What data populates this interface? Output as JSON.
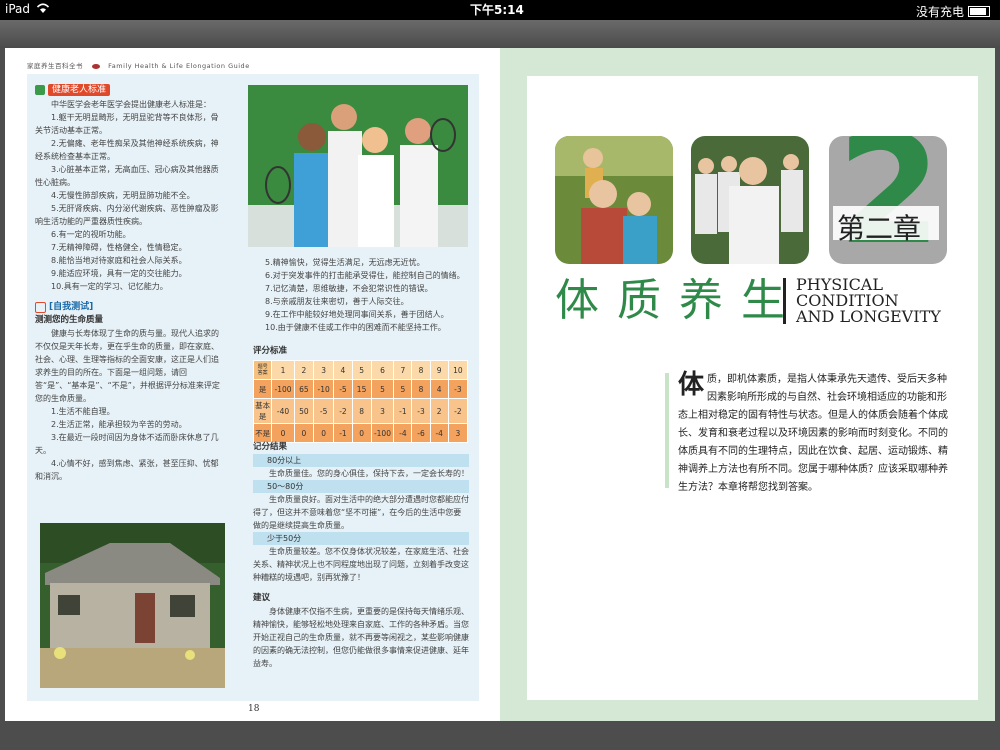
{
  "statusbar": {
    "device": "iPad",
    "time": "下午5:14",
    "battery_text": "没有充电"
  },
  "left_page": {
    "header_cn": "家庭养生百科全书",
    "header_en": "Family Health & Life Elongation Guide",
    "page_number": "18",
    "section1": {
      "title": "健康老人标准",
      "intro": "中华医学会老年医学会提出健康老人标准是：",
      "items": [
        "1.躯干无明显畸形，无明显驼背等不良体形，骨关节活动基本正常。",
        "2.无偏瘫、老年性痴呆及其他神经系统疾病，神经系统检查基本正常。",
        "3.心脏基本正常，无高血压、冠心病及其他器质性心脏病。",
        "4.无慢性肺部疾病，无明显肺功能不全。",
        "5.无肝肾疾病、内分泌代谢疾病、恶性肿瘤及影响生活功能的严重器质性疾病。",
        "6.有一定的视听功能。",
        "7.无精神障碍，性格健全，性情稳定。",
        "8.能恰当地对待家庭和社会人际关系。",
        "9.能适应环境，具有一定的交往能力。",
        "10.具有一定的学习、记忆能力。"
      ]
    },
    "section2": {
      "title": "[自我测试]",
      "subtitle": "测测您的生命质量",
      "body": "健康与长寿体现了生命的质与量。现代人追求的不仅仅是天年长寿，更在乎生命的质量，即在家庭、社会、心理、生理等指标的全面安康，这正是人们追求养生的目的所在。下面是一组问题，请回答“是”、“基本是”、“不是”，并根据评分标准来评定您的生命质量。",
      "items": [
        "1.生活不能自理。",
        "2.生活正常，能承担较为辛苦的劳动。",
        "3.在最近一段时间因为身体不适而卧床休息了几天。",
        "4.心情不好，感到焦虑、紧张，甚至压抑、忧郁和消沉。"
      ],
      "items_cont": [
        "5.精神愉快，觉得生活满足，无远虑无近忧。",
        "6.对于突发事件的打击能承受得住，能控制自己的情绪。",
        "7.记忆清楚，思维敏捷，不会犯常识性的错误。",
        "8.与亲戚朋友往来密切，善于人际交往。",
        "9.在工作中能较好地处理同事间关系，善于团结人。",
        "10.由于健康不佳或工作中的困难而不能坚持工作。"
      ]
    },
    "score_table": {
      "title": "评分标准",
      "corner_top": "题号",
      "corner_bottom": "答案",
      "columns": [
        "1",
        "2",
        "3",
        "4",
        "5",
        "6",
        "7",
        "8",
        "9",
        "10"
      ],
      "rows": [
        {
          "label": "是",
          "values": [
            "-100",
            "65",
            "-10",
            "-5",
            "15",
            "5",
            "5",
            "8",
            "4",
            "-3"
          ]
        },
        {
          "label": "基本是",
          "values": [
            "-40",
            "50",
            "-5",
            "-2",
            "8",
            "3",
            "-1",
            "-3",
            "2",
            "-2"
          ]
        },
        {
          "label": "不是",
          "values": [
            "0",
            "0",
            "0",
            "-1",
            "0",
            "-100",
            "-4",
            "-6",
            "-4",
            "3"
          ]
        }
      ]
    },
    "results": {
      "title": "记分结果",
      "bands": [
        {
          "range": "80分以上",
          "text": "生命质量佳。您的身心俱佳，保持下去，一定会长寿的！"
        },
        {
          "range": "50～80分",
          "text": "生命质量良好。面对生活中的绝大部分遭遇时您都能应付得了，但这并不意味着您“坚不可摧”，在今后的生活中您要做的是继续提高生命质量。"
        },
        {
          "range": "少于50分",
          "text": "生命质量较差。您不仅身体状况较差，在家庭生活、社会关系、精神状况上也不同程度地出现了问题，立刻着手改变这种糟糕的境遇吧，别再犹豫了！"
        }
      ]
    },
    "advice": {
      "title": "建议",
      "text": "身体健康不仅指不生病，更重要的是保持每天情绪乐观、精神愉快，能够轻松地处理来自家庭、工作的各种矛盾。当您开始正视自己的生命质量，就不再要等闲视之，某些影响健康的因素的确无法控制，但您仍能做很多事情来促进健康、延年益寿。"
    }
  },
  "right_page": {
    "chapter_number": "2",
    "chapter_label": "第二章",
    "title_cn": "体质养生",
    "title_en_lines": [
      "PHYSICAL",
      "CONDITION",
      "AND LONGEVITY"
    ],
    "intro_dropcap": "体",
    "intro_text": "质，即机体素质，是指人体秉承先天遗传、受后天多种因素影响所形成的与自然、社会环境相适应的功能和形态上相对稳定的固有特性与状态。但是人的体质会随着个体成长、发育和衰老过程以及环境因素的影响而时刻变化。不同的体质具有不同的生理特点，因此在饮食、起居、运动锻炼、精神调养上方法也有所不同。您属于哪种体质？应该采取哪种养生方法？本章将帮您找到答案。"
  },
  "colors": {
    "accent_green": "#2f8a4a",
    "accent_red": "#e04a2b",
    "table_orange": "#f4a35e"
  }
}
